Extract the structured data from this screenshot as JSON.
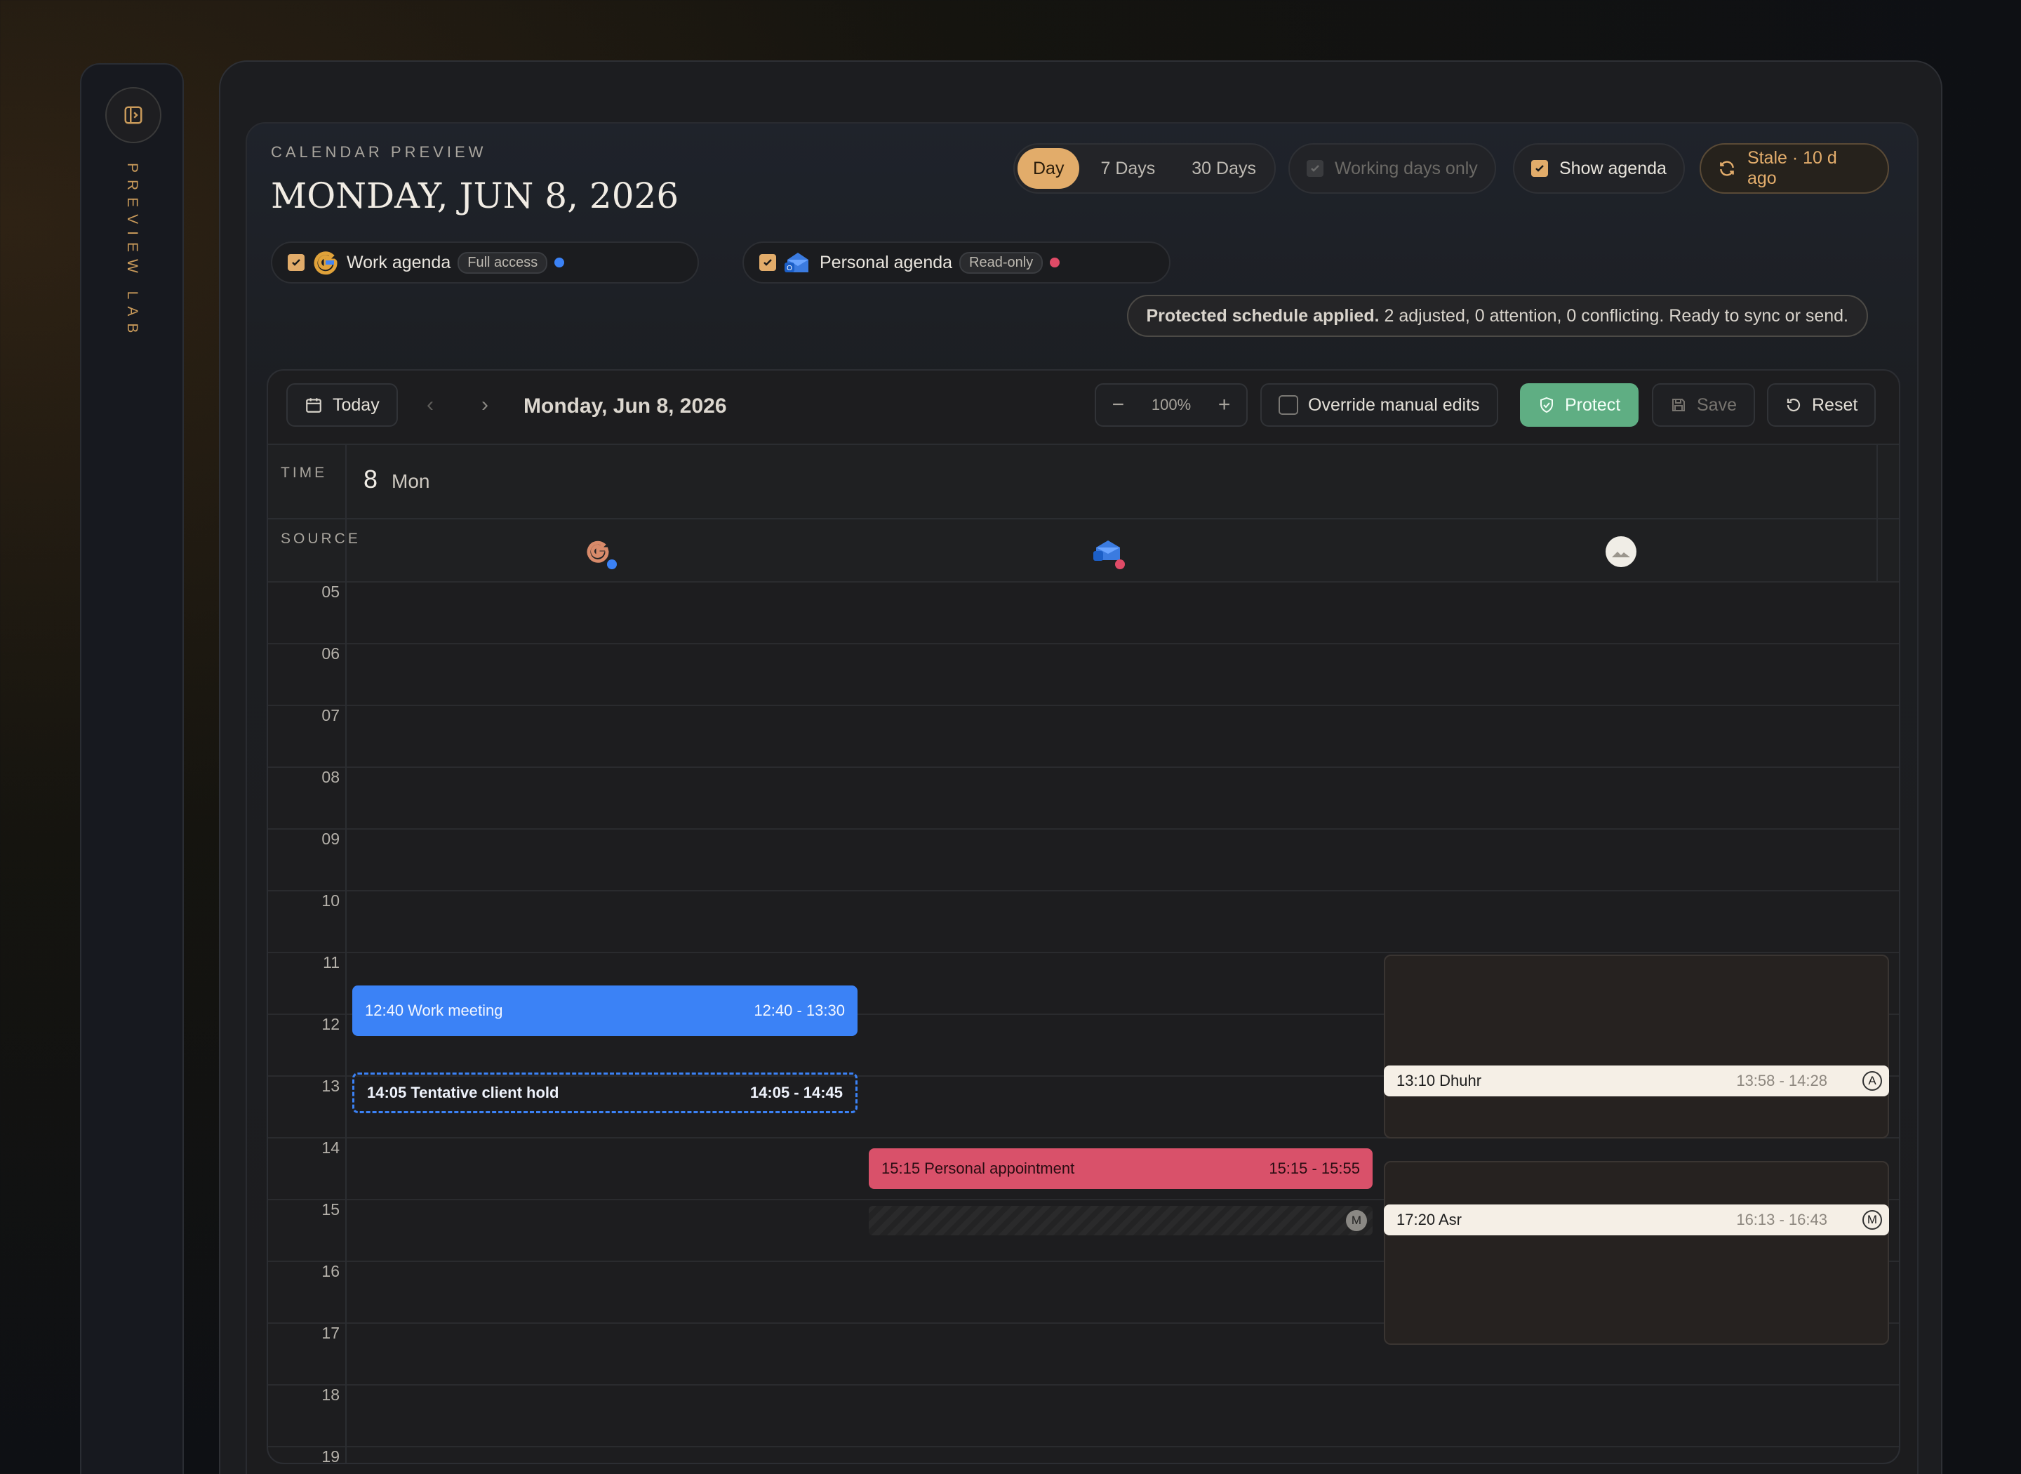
{
  "sidebar": {
    "label": "PREVIEW LAB"
  },
  "header": {
    "eyebrow": "CALENDAR PREVIEW",
    "title": "MONDAY, JUN 8, 2026"
  },
  "sources": [
    {
      "label": "Work agenda",
      "badge": "Full access",
      "color": "#3b82f6",
      "icon": "google-icon"
    },
    {
      "label": "Personal agenda",
      "badge": "Read-only",
      "color": "#e04b67",
      "icon": "outlook-icon"
    }
  ],
  "views": {
    "day": "Day",
    "week": "7 Days",
    "month": "30 Days",
    "selected": "Day"
  },
  "working_days": {
    "label": "Working days only",
    "checked": true,
    "disabled": true
  },
  "show_agenda": {
    "label": "Show agenda",
    "checked": true
  },
  "stale": {
    "label": "Stale · 10 d ago"
  },
  "status": {
    "bold": "Protected schedule applied.",
    "text": "2 adjusted, 0 attention, 0 conflicting. Ready to sync or send."
  },
  "toolbar": {
    "today": "Today",
    "date": "Monday, Jun 8, 2026",
    "zoom": "100%",
    "override": "Override manual edits",
    "protect": "Protect",
    "save": "Save",
    "reset": "Reset"
  },
  "grid": {
    "time_label": "TIME",
    "source_label": "SOURCE",
    "day_num": "8",
    "day_name": "Mon",
    "hours": [
      "05",
      "06",
      "07",
      "08",
      "09",
      "10",
      "11",
      "12",
      "13",
      "14",
      "15",
      "16",
      "17",
      "18",
      "19"
    ]
  },
  "events": [
    {
      "title": "12:40 Work meeting",
      "time": "12:40 - 13:30"
    },
    {
      "title": "14:05 Tentative client hold",
      "time": "14:05 - 14:45"
    },
    {
      "title": "15:15 Personal appointment",
      "time": "15:15 - 15:55"
    },
    {
      "title": "13:10 Dhuhr",
      "time": "13:58 - 14:28",
      "tag": "A"
    },
    {
      "title": "17:20 Asr",
      "time": "16:13 - 16:43",
      "tag": "M"
    }
  ],
  "marker": "M",
  "colors": {
    "accent": "#e2ac6a",
    "work": "#3b82f6",
    "personal": "#d9516a",
    "protect": "#5fae83"
  }
}
